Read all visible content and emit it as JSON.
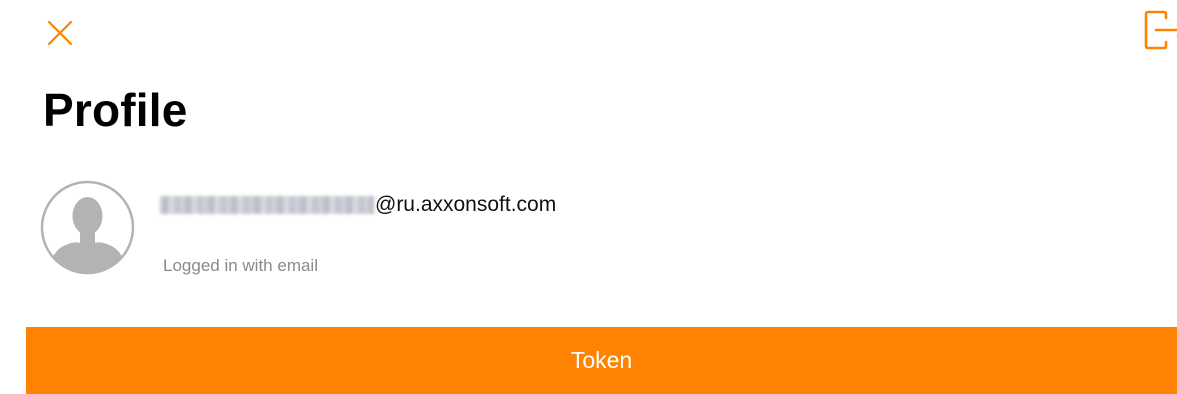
{
  "colors": {
    "accent": "#ff8300",
    "text_primary": "#000000",
    "text_secondary": "#8a8a8a",
    "background": "#ffffff",
    "avatar_gray": "#b3b3b3"
  },
  "icons": {
    "close": "close-icon",
    "logout": "logout-icon",
    "avatar": "user-silhouette-icon"
  },
  "header": {
    "title": "Profile"
  },
  "profile": {
    "email_domain": "@ru.axxonsoft.com",
    "login_method": "Logged in with email"
  },
  "actions": {
    "token_label": "Token"
  }
}
